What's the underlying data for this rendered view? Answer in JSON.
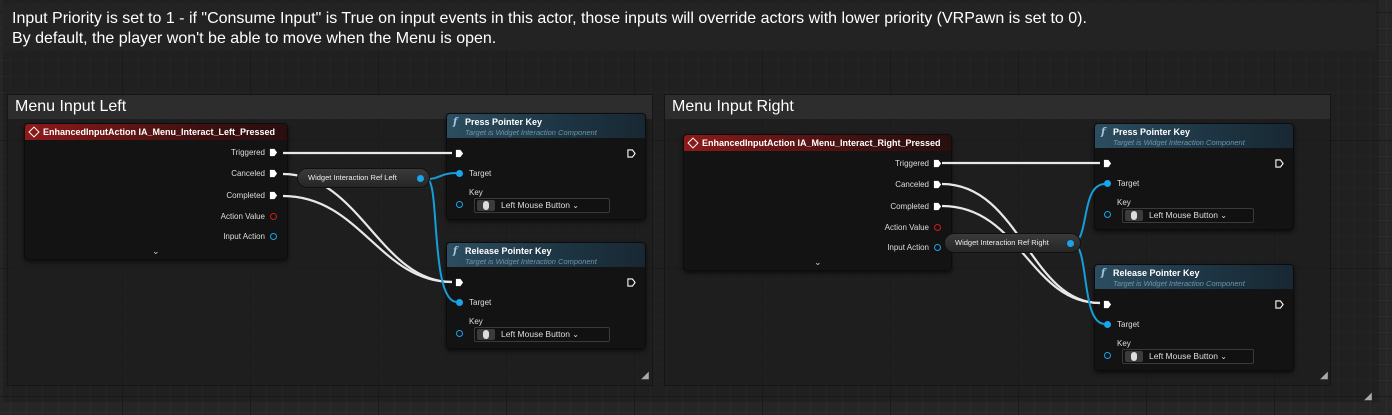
{
  "outer_comment": {
    "line1": "Input Priority is set to 1 - if \"Consume Input\" is True on input events in this actor, those inputs will override actors with lower priority (VRPawn is set to 0).",
    "line2": "By default, the player won't be able to move when the Menu is open."
  },
  "left": {
    "title": "Menu Input Left",
    "event": {
      "title": "EnhancedInputAction IA_Menu_Interact_Left_Pressed",
      "pins": [
        "Triggered",
        "Canceled",
        "Completed",
        "Action Value",
        "Input Action"
      ]
    },
    "variable": "Widget Interaction Ref Left",
    "press": {
      "title": "Press Pointer Key",
      "subtitle": "Target is Widget Interaction Component",
      "target": "Target",
      "key_label": "Key",
      "key_value": "Left Mouse Button"
    },
    "release": {
      "title": "Release Pointer Key",
      "subtitle": "Target is Widget Interaction Component",
      "target": "Target",
      "key_label": "Key",
      "key_value": "Left Mouse Button"
    }
  },
  "right": {
    "title": "Menu Input Right",
    "event": {
      "title": "EnhancedInputAction IA_Menu_Interact_Right_Pressed",
      "pins": [
        "Triggered",
        "Canceled",
        "Completed",
        "Action Value",
        "Input Action"
      ]
    },
    "variable": "Widget Interaction Ref Right",
    "press": {
      "title": "Press Pointer Key",
      "subtitle": "Target is Widget Interaction Component",
      "target": "Target",
      "key_label": "Key",
      "key_value": "Left Mouse Button"
    },
    "release": {
      "title": "Release Pointer Key",
      "subtitle": "Target is Widget Interaction Component",
      "target": "Target",
      "key_label": "Key",
      "key_value": "Left Mouse Button"
    }
  },
  "colors": {
    "exec_wire": "#e8e8e8",
    "object_wire": "#169ed8",
    "event_header": "#8e1a1a",
    "function_header": "#2c4d60"
  }
}
